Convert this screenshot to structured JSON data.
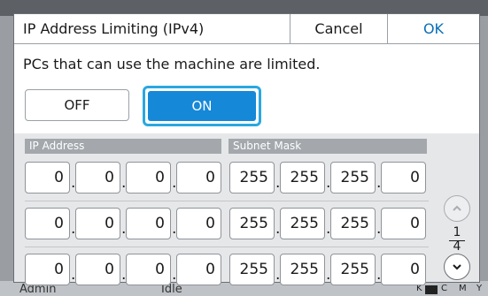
{
  "dialog": {
    "title": "IP Address Limiting (IPv4)",
    "cancel_label": "Cancel",
    "ok_label": "OK",
    "message": "PCs that can use the machine are limited."
  },
  "toggle": {
    "off_label": "OFF",
    "on_label": "ON",
    "selected": "ON"
  },
  "table": {
    "ip_header": "IP Address",
    "mask_header": "Subnet Mask",
    "rows": [
      {
        "ip": [
          "0",
          "0",
          "0",
          "0"
        ],
        "mask": [
          "255",
          "255",
          "255",
          "0"
        ]
      },
      {
        "ip": [
          "0",
          "0",
          "0",
          "0"
        ],
        "mask": [
          "255",
          "255",
          "255",
          "0"
        ]
      },
      {
        "ip": [
          "0",
          "0",
          "0",
          "0"
        ],
        "mask": [
          "255",
          "255",
          "255",
          "0"
        ]
      }
    ],
    "separator": "."
  },
  "pagination": {
    "current": "1",
    "total": "4"
  },
  "status_bar": {
    "user": "Admin",
    "status": "Idle",
    "ink_labels": [
      "K",
      "C",
      "M",
      "Y"
    ]
  },
  "colors": {
    "accent": "#1688d8",
    "highlight": "#29a8e0",
    "ok_text": "#0a6fb8"
  }
}
